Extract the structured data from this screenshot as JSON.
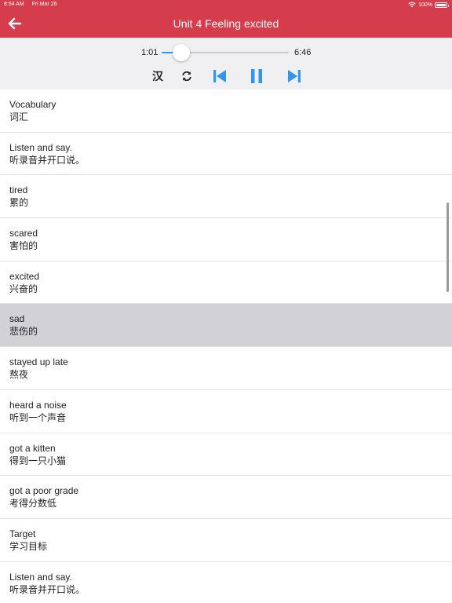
{
  "status_bar": {
    "time": "8:54 AM",
    "date": "Fri Mar 26",
    "battery": "100%"
  },
  "nav": {
    "title": "Unit 4 Feeling excited",
    "back_icon": "arrow-left-icon"
  },
  "player": {
    "current_time": "1:01",
    "total_time": "6:46",
    "progress": 0.157,
    "lang_toggle_label": "汉",
    "accent_color": "#2f97f0",
    "icons": {
      "repeat": "repeat-icon",
      "previous": "skip-previous-icon",
      "pause": "pause-icon",
      "next": "skip-next-icon"
    }
  },
  "header_color": "#d63d4c",
  "selected_index": 5,
  "items": [
    {
      "en": "Vocabulary",
      "zh": "词汇"
    },
    {
      "en": "Listen and say.",
      "zh": "听录音并开口说。"
    },
    {
      "en": "tired",
      "zh": "累的"
    },
    {
      "en": "scared",
      "zh": "害怕的"
    },
    {
      "en": "excited",
      "zh": "兴奋的"
    },
    {
      "en": "sad",
      "zh": "悲伤的"
    },
    {
      "en": "stayed up late",
      "zh": "熬夜"
    },
    {
      "en": "heard a noise",
      "zh": "听到一个声音"
    },
    {
      "en": "got a kitten",
      "zh": "得到一只小猫"
    },
    {
      "en": "got a poor grade",
      "zh": "考得分数低"
    },
    {
      "en": "Target",
      "zh": "学习目标"
    },
    {
      "en": "Listen and say.",
      "zh": "听录音并开口说。"
    }
  ]
}
